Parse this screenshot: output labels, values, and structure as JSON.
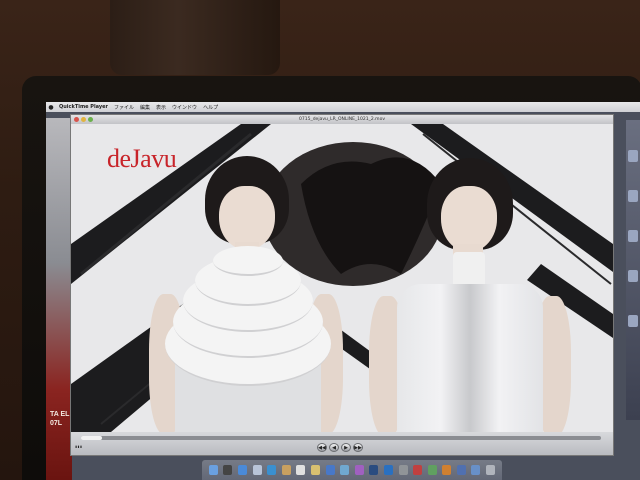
{
  "menubar": {
    "apple": "",
    "app_name": "QuickTime Player",
    "items": [
      "ファイル",
      "編集",
      "表示",
      "ウインドウ",
      "ヘルプ"
    ]
  },
  "window": {
    "title": "0715_dejavu_LR_ONLINE_1021_2.mov"
  },
  "video": {
    "logo_text": "deJavu"
  },
  "desktop": {
    "poster_text": "TA EL\n07L"
  },
  "controls": {
    "progress": 0.04,
    "buttons": [
      "◀◀",
      "◀",
      "▶",
      "▶▶"
    ]
  },
  "colors": {
    "logo": "#c8242a"
  }
}
